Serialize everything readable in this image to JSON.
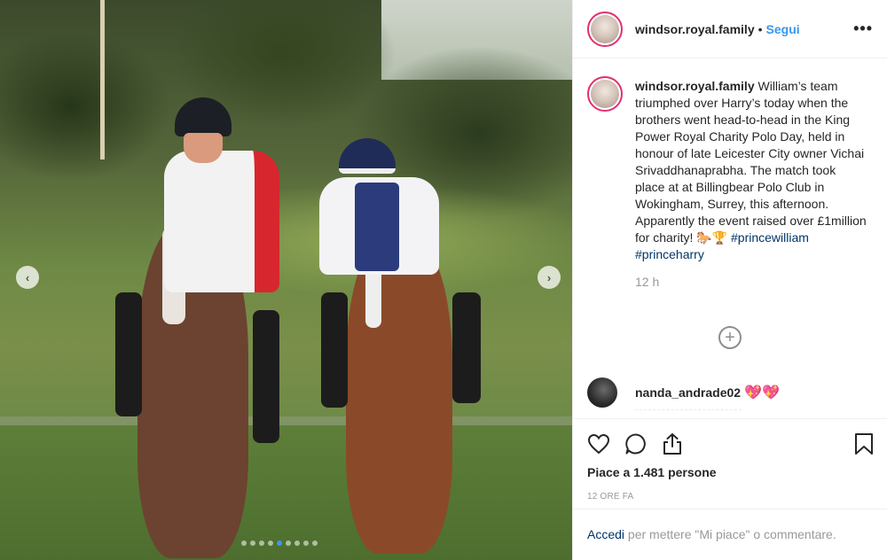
{
  "post": {
    "username": "windsor.royal.family",
    "header_separator": "•",
    "follow_label": "Segui",
    "more_label": "•••",
    "caption_text": "William’s team triumphed over Harry’s today when the brothers went head-to-head in the King Power Royal Charity Polo Day, held in honour of late Leicester City owner Vichai Srivaddhanaprabha. The match took place at at Billingbear Polo Club in Wokingham, Surrey, this afternoon. Apparently the event raised over £1million for charity! 🐎🏆",
    "caption_tags": "#princewilliam #princeharry",
    "time": "12 h",
    "add_comment": "+",
    "likes": "Piace a 1.481 persone",
    "ago": "12 ORE FA"
  },
  "comment": {
    "username": "nanda_andrade02",
    "emoji": "💖💖"
  },
  "carousel": {
    "prev_label": "‹",
    "next_label": "›",
    "total_slides": 9,
    "active_index": 4
  },
  "login": {
    "link": "Accedi",
    "text": " per mettere \"Mi piace\" o commentare."
  },
  "colors": {
    "link_blue": "#3897f0",
    "hashtag": "#003569",
    "muted": "#999999",
    "story_ring": "#e1306c"
  },
  "icons": [
    "heart-icon",
    "comment-icon",
    "share-icon",
    "bookmark-icon",
    "more-icon",
    "add-comment-icon"
  ]
}
